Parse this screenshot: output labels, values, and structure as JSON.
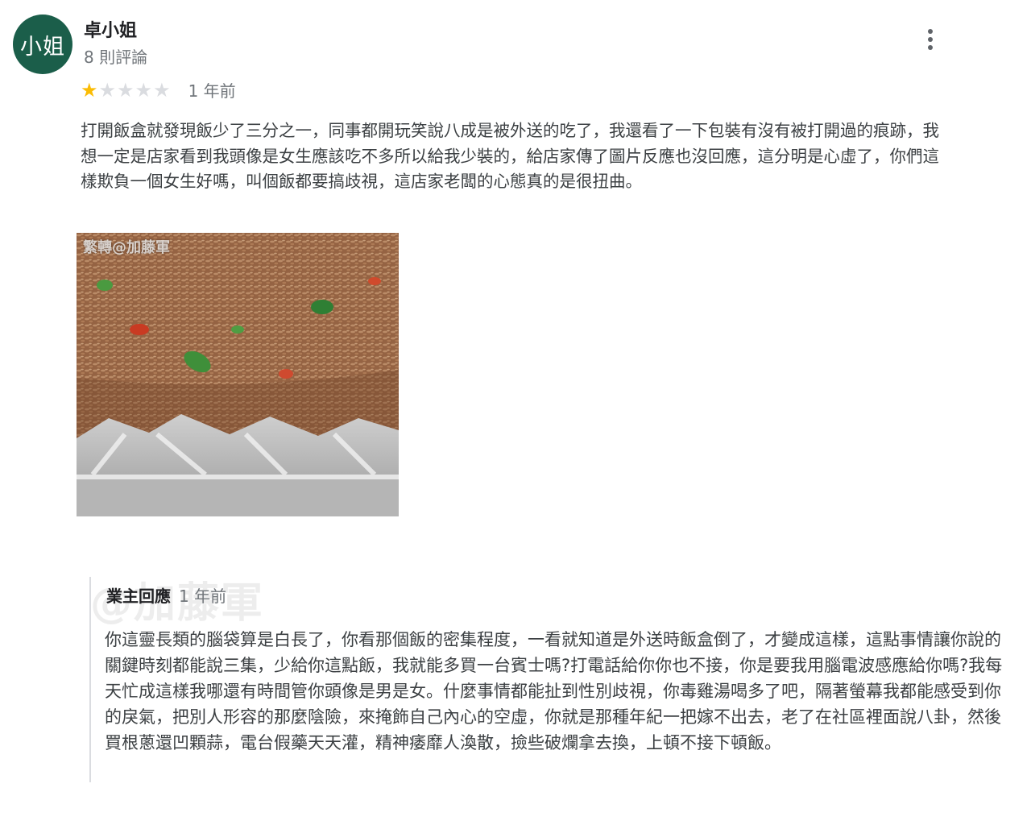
{
  "reviewer": {
    "avatar_text": "小姐",
    "name": "卓小姐",
    "review_count": "8 則評論"
  },
  "review": {
    "rating": 1,
    "max_rating": 5,
    "star_filled_color": "#fbbc04",
    "star_empty_color": "#dadce0",
    "time": "1 年前",
    "text": "打開飯盒就發現飯少了三分之一，同事都開玩笑說八成是被外送的吃了，我還看了一下包裝有沒有被打開過的痕跡，我想一定是店家看到我頭像是女生應該吃不多所以給我少裝的，給店家傳了圖片反應也沒回應，這分明是心虛了，你們這樣欺負一個女生好嗎，叫個飯都要搞歧視，這店家老闆的心態真的是很扭曲。",
    "photo": {
      "watermark": "繁轉@加藤軍"
    }
  },
  "owner_response": {
    "label": "業主回應",
    "time": "1 年前",
    "watermark": "@加藤軍",
    "text": "你這靈長類的腦袋算是白長了，你看那個飯的密集程度，一看就知道是外送時飯盒倒了，才變成這樣，這點事情讓你說的關鍵時刻都能說三集，少給你這點飯，我就能多買一台賓士嗎?打電話給你你也不接，你是要我用腦電波感應給你嗎?我每天忙成這樣我哪還有時間管你頭像是男是女。什麼事情都能扯到性別歧視，你毒雞湯喝多了吧，隔著螢幕我都能感受到你的戾氣，把別人形容的那麼陰險，來掩飾自己內心的空虛，你就是那種年紀一把嫁不出去，老了在社區裡面說八卦，然後買根蔥還凹顆蒜，電台假藥天天灌，精神痿靡人渙散，撿些破爛拿去換，上頓不接下頓飯。"
  },
  "icons": {
    "menu": "more-vertical-icon",
    "star": "star-icon"
  }
}
